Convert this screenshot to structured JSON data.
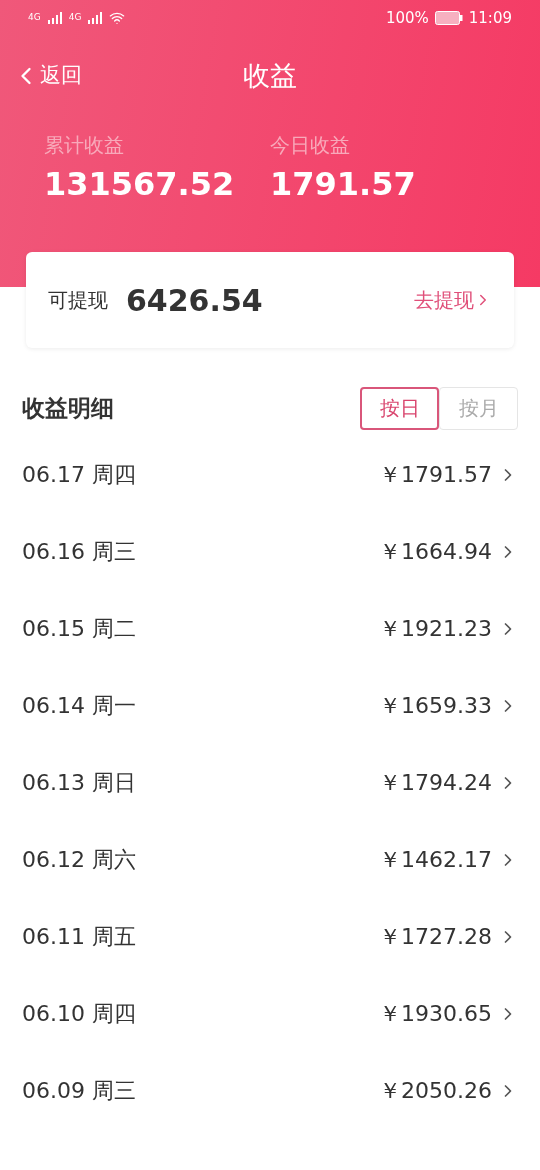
{
  "status_bar": {
    "network_1": "4G",
    "network_2": "4G",
    "battery": "100%",
    "time": "11:09"
  },
  "nav": {
    "back": "返回",
    "title": "收益"
  },
  "summary": [
    {
      "label": "累计收益",
      "value": "131567.52"
    },
    {
      "label": "今日收益",
      "value": "1791.57"
    }
  ],
  "withdraw": {
    "label": "可提现",
    "value": "6426.54",
    "action": "去提现"
  },
  "detail": {
    "title": "收益明细",
    "toggle": [
      {
        "label": "按日",
        "selected": true
      },
      {
        "label": "按月",
        "selected": false
      }
    ]
  },
  "rows": [
    {
      "date": "06.17 周四",
      "amount": "￥1791.57"
    },
    {
      "date": "06.16 周三",
      "amount": "￥1664.94"
    },
    {
      "date": "06.15 周二",
      "amount": "￥1921.23"
    },
    {
      "date": "06.14 周一",
      "amount": "￥1659.33"
    },
    {
      "date": "06.13 周日",
      "amount": "￥1794.24"
    },
    {
      "date": "06.12 周六",
      "amount": "￥1462.17"
    },
    {
      "date": "06.11 周五",
      "amount": "￥1727.28"
    },
    {
      "date": "06.10 周四",
      "amount": "￥1930.65"
    },
    {
      "date": "06.09 周三",
      "amount": "￥2050.26"
    }
  ]
}
